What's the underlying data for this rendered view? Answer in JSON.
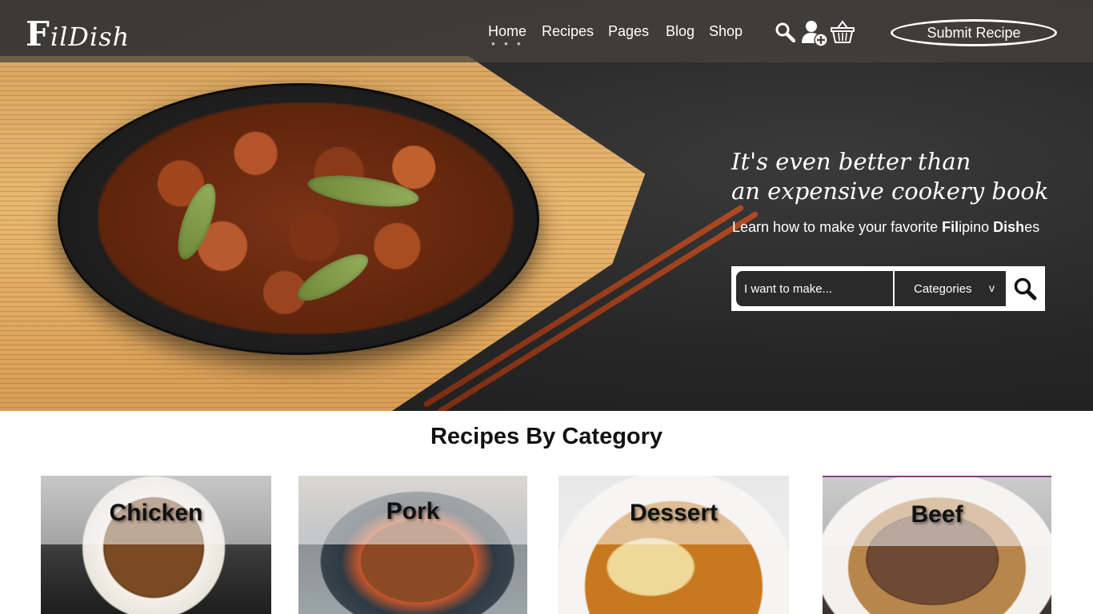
{
  "brand": {
    "logo_first": "F",
    "logo_rest": "ilDish"
  },
  "nav": {
    "items": [
      "Home",
      "Recipes",
      "Pages",
      "Blog",
      "Shop"
    ],
    "active_marker": "* * *",
    "submit_label": "Submit Recipe",
    "icons": [
      "search-icon",
      "user-add-icon",
      "basket-icon"
    ]
  },
  "hero": {
    "tagline_line1": "It's even better than",
    "tagline_line2": "an expensive cookery book",
    "subline_pre": "Learn how to make your favorite ",
    "subline_fil": "Fil",
    "subline_ipino": "ipino ",
    "subline_dish": "Dish",
    "subline_es": "es"
  },
  "search": {
    "placeholder": "I want to make...",
    "category_label": "Categories",
    "category_chevron": "v"
  },
  "categories": {
    "title": "Recipes By Category",
    "items": [
      {
        "label": "Chicken"
      },
      {
        "label": "Pork"
      },
      {
        "label": "Dessert"
      },
      {
        "label": "Beef"
      }
    ]
  },
  "colors": {
    "nav_bg": "#46423f",
    "accent": "#ffffff",
    "text_dark": "#111111"
  }
}
